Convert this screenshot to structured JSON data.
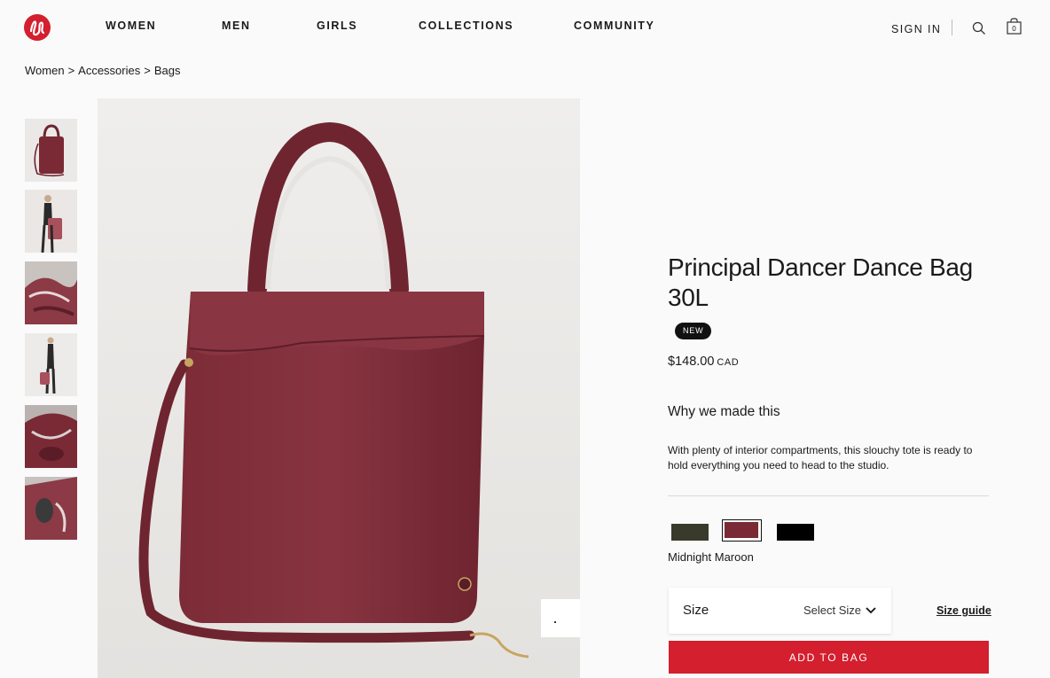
{
  "brand": {
    "logo_icon": "lululemon-logo-icon",
    "logo_color": "#d31f2e"
  },
  "nav": {
    "items": [
      {
        "label": "WOMEN"
      },
      {
        "label": "MEN"
      },
      {
        "label": "GIRLS"
      },
      {
        "label": "COLLECTIONS"
      },
      {
        "label": "COMMUNITY"
      }
    ],
    "sign_in": "SIGN IN",
    "search_icon": "search-icon",
    "bag_icon": "shopping-bag-icon",
    "bag_count": "0"
  },
  "breadcrumb": {
    "items": [
      "Women",
      "Accessories",
      "Bags"
    ],
    "separator": ">"
  },
  "gallery": {
    "thumbnails": [
      {
        "alt": "bag-front"
      },
      {
        "alt": "model-carrying-bag"
      },
      {
        "alt": "bag-interior"
      },
      {
        "alt": "model-full-body"
      },
      {
        "alt": "bag-interior-detail"
      },
      {
        "alt": "bag-pocket-detail"
      }
    ]
  },
  "product": {
    "title": "Principal Dancer Dance Bag 30L",
    "badge": "NEW",
    "price": "$148.00",
    "currency": "CAD",
    "why_title": "Why we made this",
    "why_body": "With plenty of interior compartments, this slouchy tote is ready to hold everything you need to head to the studio.",
    "colors": [
      {
        "name": "dark-olive",
        "hex": "#3a3a2c"
      },
      {
        "name": "Midnight Maroon",
        "hex": "#7a2a35"
      },
      {
        "name": "black",
        "hex": "#000000"
      }
    ],
    "selected_color_label": "Midnight Maroon",
    "size_label": "Size",
    "size_placeholder": "Select Size",
    "size_guide": "Size guide",
    "add_to_bag": "ADD TO BAG"
  },
  "colors": {
    "accent": "#d31f2e",
    "text": "#1a1a1a",
    "background": "#fafafa"
  }
}
